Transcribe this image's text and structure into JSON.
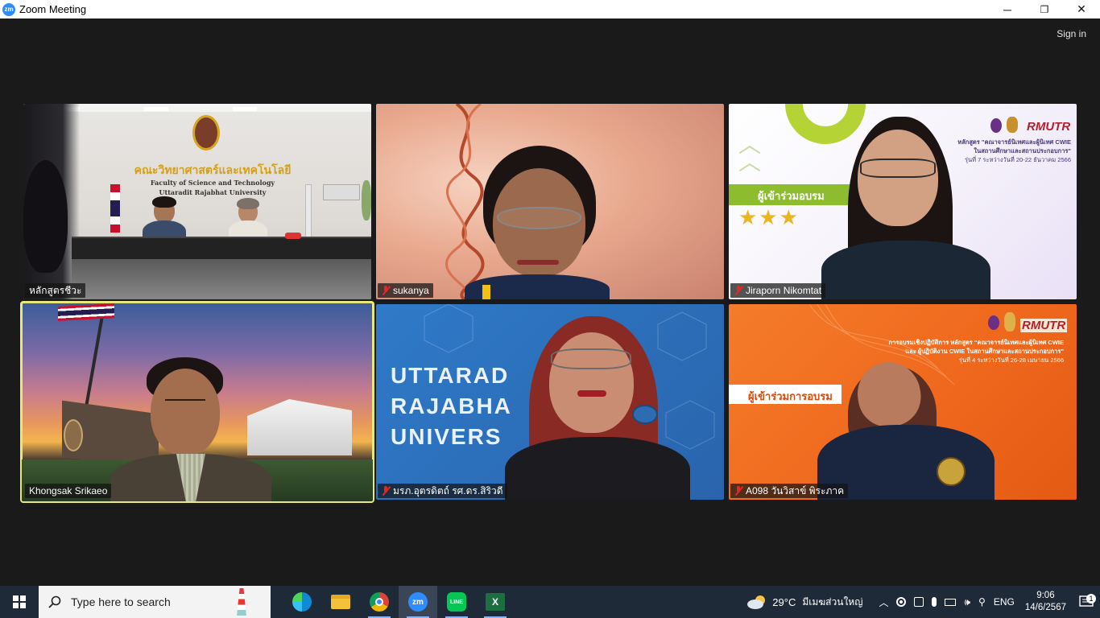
{
  "window": {
    "title": "Zoom Meeting",
    "controls": {
      "minimize": "─",
      "maximize": "❐",
      "close": "✕"
    }
  },
  "meeting": {
    "sign_in": "Sign in",
    "participants": [
      {
        "name": "หลักสูตรชีวะ",
        "muted": false,
        "active": false
      },
      {
        "name": "sukanya",
        "muted": true,
        "active": false
      },
      {
        "name": "Jiraporn Nikomtat",
        "muted": true,
        "active": false
      },
      {
        "name": "Khongsak Srikaeo",
        "muted": false,
        "active": true
      },
      {
        "name": "มรภ.อุตรดิตถ์ รศ.ดร.สิริวดี",
        "muted": true,
        "active": false
      },
      {
        "name": "A098 วันวิสาข์ พิระภาค",
        "muted": true,
        "active": false
      }
    ],
    "tile1_sign_thai": "คณะวิทยาศาสตร์และเทคโนโลยี",
    "tile1_sign_en1": "Faculty of Science and Technology",
    "tile1_sign_en2": "Uttaradit Rajabhat University",
    "tile3_badge": "ผู้เข้าร่วมอบรม",
    "tile3_logo": "RMUTR",
    "tile3_header1": "หลักสูตร \"คณาจารย์นิเทศและผู้นิเทศ CWIE",
    "tile3_header2": "ในสถานศึกษาและสถานประกอบการ\"",
    "tile3_header3": "รุ่นที่ 7 ระหว่างวันที่ 20-22 ธันวาคม 2566",
    "tile3_stars": "★★★",
    "tile5_text": [
      "UTTARAD",
      "RAJABHA",
      "UNIVERS"
    ],
    "tile6_logo": "RMUTR",
    "tile6_header1": "การอบรมเชิงปฏิบัติการ หลักสูตร \"คณาจารย์นิเทศและผู้นิเทศ CWIE",
    "tile6_header2": "และ ผู้ปฏิบัติงาน CWIE ในสถานศึกษาและสถานประกอบการ\"",
    "tile6_header3": "รุ่นที่ 4 ระหว่างวันที่ 26-28 เมษายน 2566",
    "tile6_badge": "ผู้เข้าร่วมการอบรม"
  },
  "taskbar": {
    "search_placeholder": "Type here to search",
    "apps": [
      "edge-icon",
      "file-explorer-icon",
      "chrome-icon",
      "zoom-icon",
      "line-icon",
      "excel-icon"
    ],
    "weather_temp": "29°C",
    "weather_desc": "มีเมฆส่วนใหญ่",
    "language": "ENG",
    "time": "9:06",
    "date": "14/6/2567",
    "notification_count": "1"
  },
  "colors": {
    "zoom_blue": "#2d8cff",
    "active_speaker": "#e8e87a",
    "taskbar": "#1f2a38",
    "muted_red": "#e02828"
  }
}
